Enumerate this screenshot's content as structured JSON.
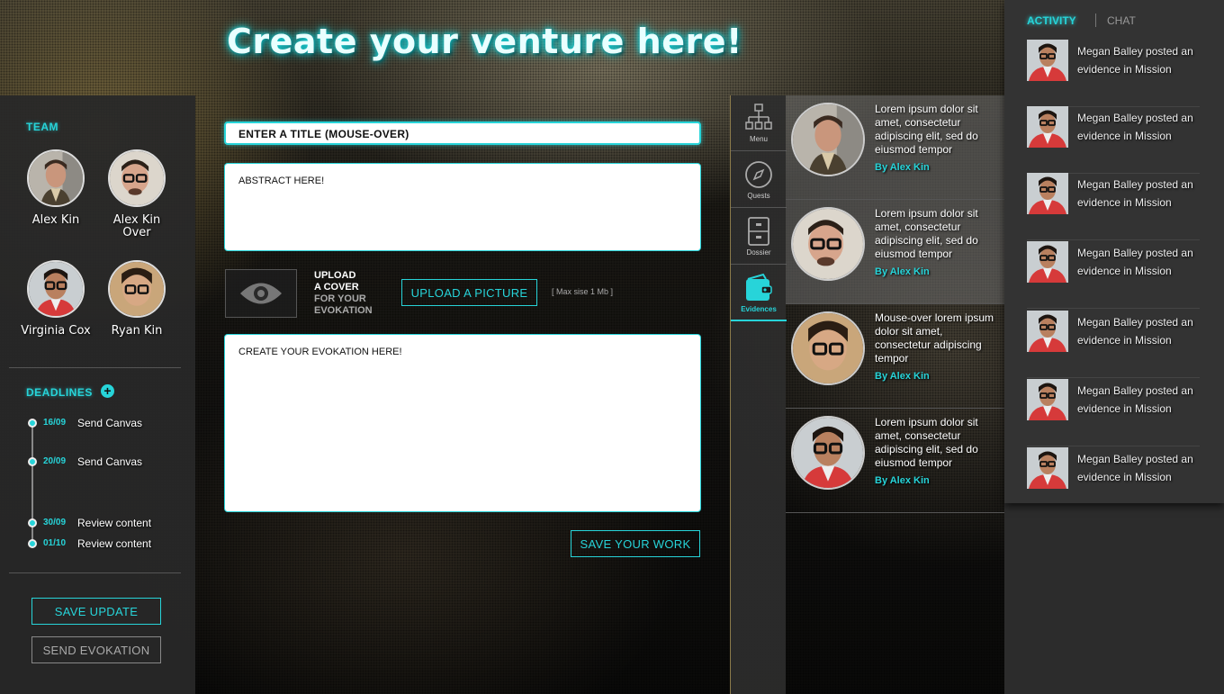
{
  "header": {
    "title": "Create your venture here!"
  },
  "team": {
    "title": "TEAM",
    "members": [
      {
        "name": "Alex Kin"
      },
      {
        "name": "Alex Kin Over"
      },
      {
        "name": "Virginia Cox"
      },
      {
        "name": "Ryan Kin"
      }
    ]
  },
  "deadlines": {
    "title": "DEADLINES",
    "add_icon": "plus-circle-icon",
    "items": [
      {
        "date": "16/09",
        "label": "Send Canvas"
      },
      {
        "date": "20/09",
        "label": "Send Canvas"
      },
      {
        "date": "30/09",
        "label": "Review content"
      },
      {
        "date": "01/10",
        "label": "Review content"
      }
    ]
  },
  "left_buttons": {
    "save_update": "SAVE UPDATE",
    "send_evokation": "SEND EVOKATION"
  },
  "form": {
    "title_value": "ENTER A TITLE (MOUSE-OVER)",
    "abstract_value": "ABSTRACT HERE!",
    "cover_line1": "UPLOAD",
    "cover_line2": "A COVER",
    "cover_line3": "FOR YOUR",
    "cover_line4": "EVOKATION",
    "upload_button": "UPLOAD A PICTURE",
    "max_size": "[ Max sise 1 Mb ]",
    "evokation_value": "CREATE YOUR EVOKATION HERE!",
    "save_button": "SAVE YOUR WORK"
  },
  "side_menu": [
    {
      "label": "Menu",
      "icon": "sitemap-icon"
    },
    {
      "label": "Quests",
      "icon": "compass-icon"
    },
    {
      "label": "Dossier",
      "icon": "cabinet-icon"
    },
    {
      "label": "Evidences",
      "icon": "wallet-icon",
      "active": true
    }
  ],
  "evidences": [
    {
      "text": "Lorem ipsum dolor sit amet, consectetur adipiscing elit, sed do eiusmod tempor",
      "by": "By Alex Kin"
    },
    {
      "text": "Lorem ipsum dolor sit amet, consectetur adipiscing elit, sed do eiusmod tempor",
      "by": "By Alex Kin"
    },
    {
      "text": "Mouse-over lorem ipsum dolor sit amet, consectetur adipiscing tempor",
      "by": "By Alex Kin"
    },
    {
      "text": "Lorem ipsum dolor sit amet, consectetur adipiscing elit, sed do eiusmod tempor",
      "by": "By Alex Kin"
    }
  ],
  "activity": {
    "tab_activity": "ACTIVITY",
    "tab_chat": "CHAT",
    "items": [
      {
        "text": "Megan Balley posted an evidence in Mission"
      },
      {
        "text": "Megan Balley posted an evidence in Mission"
      },
      {
        "text": "Megan Balley posted an evidence in Mission"
      },
      {
        "text": "Megan Balley posted an evidence in Mission"
      },
      {
        "text": "Megan Balley posted an evidence in Mission"
      },
      {
        "text": "Megan Balley posted an evidence in Mission"
      },
      {
        "text": "Megan Balley posted an evidence in Mission"
      }
    ]
  },
  "colors": {
    "accent": "#27d4d9",
    "panel": "#2c2c2c"
  }
}
